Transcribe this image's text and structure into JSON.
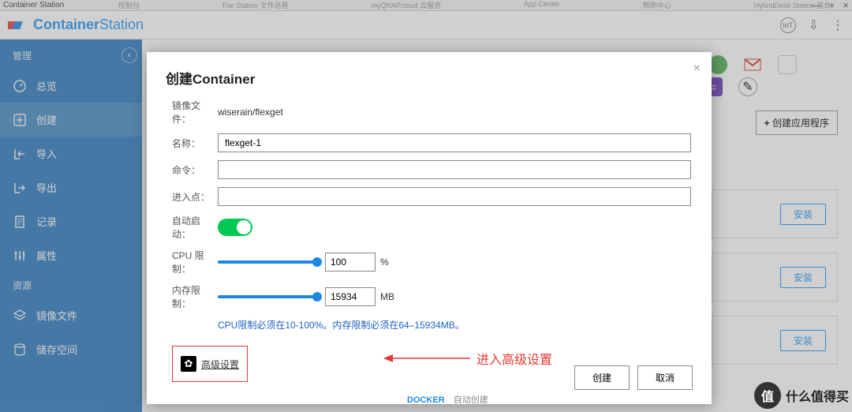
{
  "os": {
    "title": "Container Station",
    "tabs": [
      "控制台",
      "File Station 文件总管",
      "myQNAPcloud 云服务",
      "App Center",
      "帮助中心",
      "HybridDesk Station 混合"
    ],
    "ctrl": {
      "min": "—",
      "max": "+",
      "close": "×"
    }
  },
  "header": {
    "brand_bold": "Container",
    "brand_light": "Station",
    "icons": {
      "iot": "IoT",
      "download": "⇩",
      "more": "⋮"
    }
  },
  "sidebar": {
    "section1": "管理",
    "items": [
      {
        "label": "总览"
      },
      {
        "label": "创建"
      },
      {
        "label": "导入"
      },
      {
        "label": "导出"
      },
      {
        "label": "记录"
      },
      {
        "label": "属性"
      }
    ],
    "section2": "资源",
    "items2": [
      {
        "label": "镜像文件"
      },
      {
        "label": "储存空间"
      }
    ]
  },
  "main": {
    "create_app_btn": "创建应用程序",
    "install_btn": "安装",
    "docker": "DOCKER",
    "docker_sub": "自动创建"
  },
  "modal": {
    "title": "创建Container",
    "labels": {
      "image": "镜像文件：",
      "name": "名称：",
      "cmd": "命令：",
      "entry": "进入点：",
      "autostart": "自动启动：",
      "cpu": "CPU 限制：",
      "mem": "内存限制："
    },
    "values": {
      "image": "wiserain/flexget",
      "name": "flexget-1",
      "cmd": "",
      "entry": "",
      "cpu": "100",
      "cpu_unit": "%",
      "mem": "15934",
      "mem_unit": "MB"
    },
    "hint": "CPU限制必须在10-100%。内存限制必须在64–15934MB。",
    "advanced": "高级设置",
    "annotation": "进入高级设置",
    "buttons": {
      "ok": "创建",
      "cancel": "取消"
    }
  },
  "watermark": {
    "badge": "值",
    "text": "什么值得买"
  }
}
